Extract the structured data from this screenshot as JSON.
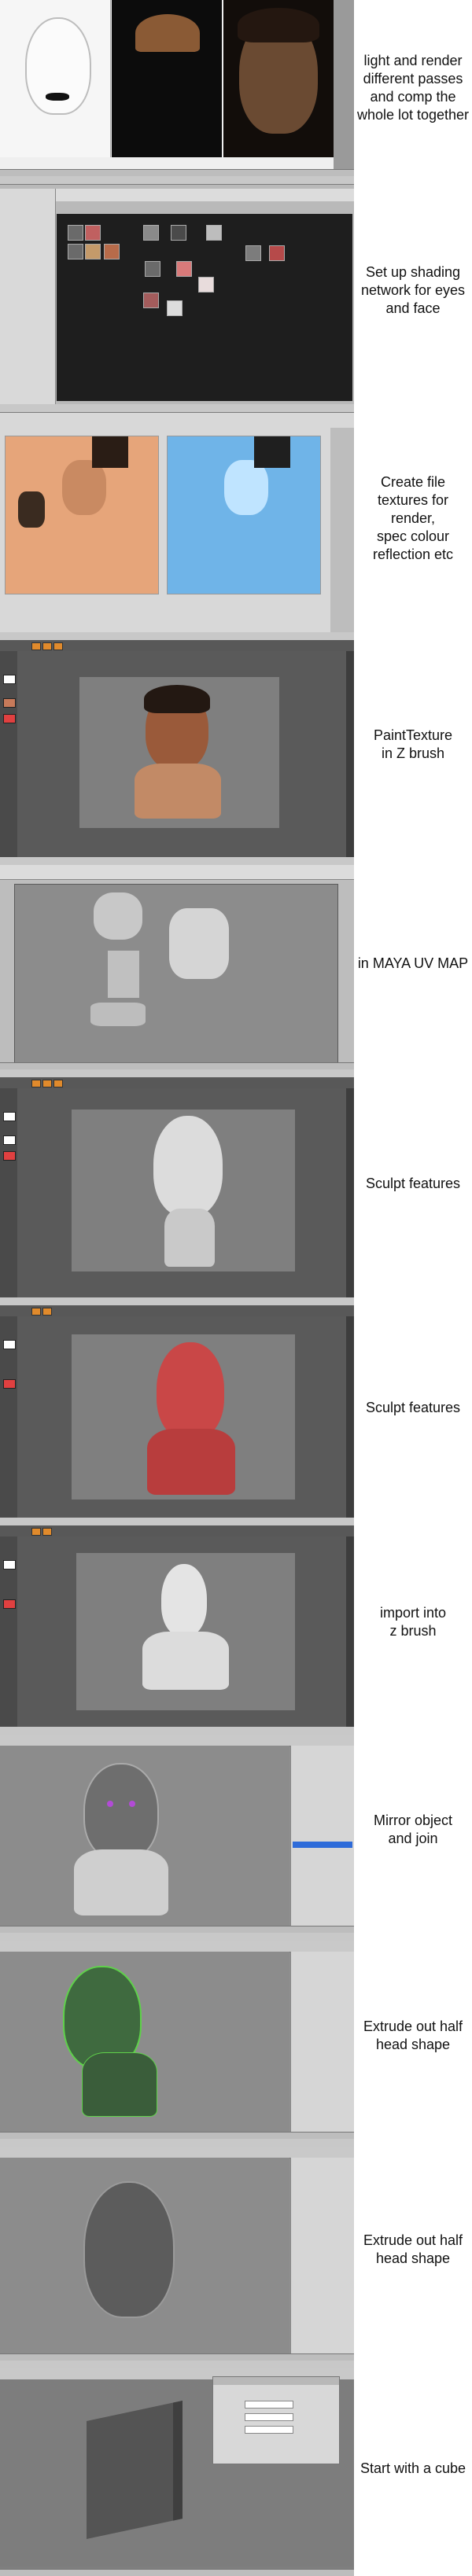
{
  "captions": {
    "render_passes": "light and render\ndifferent passes\nand comp the\nwhole lot together",
    "shading_network": "Set up shading\nnetwork for eyes\nand face",
    "file_textures": "Create file\ntextures for render,\nspec colour\nreflection etc",
    "paint_texture": "PaintTexture\nin Z brush",
    "uv_map": "in MAYA UV MAP",
    "sculpt_features_gray": "Sculpt features",
    "sculpt_features_red": "Sculpt features",
    "import_zbrush": "import into\nz brush",
    "mirror_join": "Mirror object\nand join",
    "extrude_half_green": "Extrude out half\nhead shape",
    "extrude_half_gray": "Extrude out half\nhead shape",
    "start_cube": "Start with a cube"
  },
  "colors": {
    "skin": "#b27a55",
    "skin_dark": "#5a3a26",
    "hair": "#2a1a12",
    "clay_gray": "#d9d9d9",
    "clay_red": "#c94747",
    "uv_tex_orange": "#e6a57a",
    "uv_tex_blue": "#6fb4e8",
    "ui_orange": "#e08a2c",
    "select_green": "#5fd14a",
    "mesh_gray": "#7f7f7f",
    "node_editor_bg": "#1e1e1e"
  },
  "icons": [
    "menu-bar",
    "toolbar-buttons",
    "color-swatch",
    "brush-icon",
    "shader-node-icon"
  ]
}
